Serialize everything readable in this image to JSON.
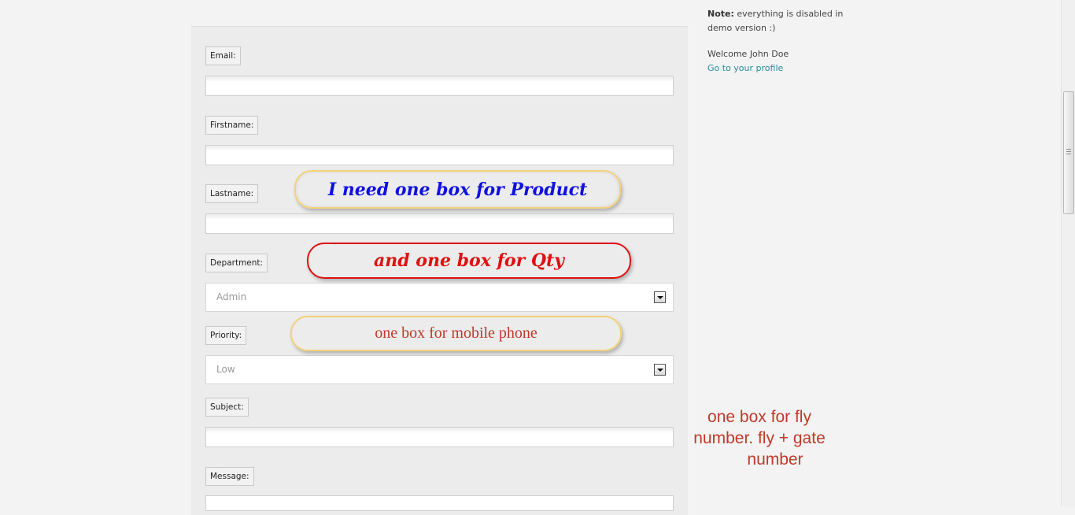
{
  "sidebar": {
    "note_label": "Note:",
    "note_text": "everything is disabled in demo version :)",
    "welcome": "Welcome John Doe",
    "profile_link": "Go to your profile"
  },
  "form": {
    "email_label": "Email:",
    "firstname_label": "Firstname:",
    "lastname_label": "Lastname:",
    "department_label": "Department:",
    "department_value": "Admin",
    "priority_label": "Priority:",
    "priority_value": "Low",
    "subject_label": "Subject:",
    "message_label": "Message:"
  },
  "annotations": {
    "product": "I need one box for Product",
    "qty": "and one box for Qty",
    "mobile": "one box for mobile phone",
    "fly_line1": "one box for fly",
    "fly_line2": "number. fly + gate",
    "fly_line3": "number"
  },
  "colors": {
    "link": "#2a8a99",
    "annotation_blue": "#1010e0",
    "annotation_red": "#e01010",
    "annotation_brown": "#c0392b",
    "highlight_yellow": "#f3d27a"
  }
}
